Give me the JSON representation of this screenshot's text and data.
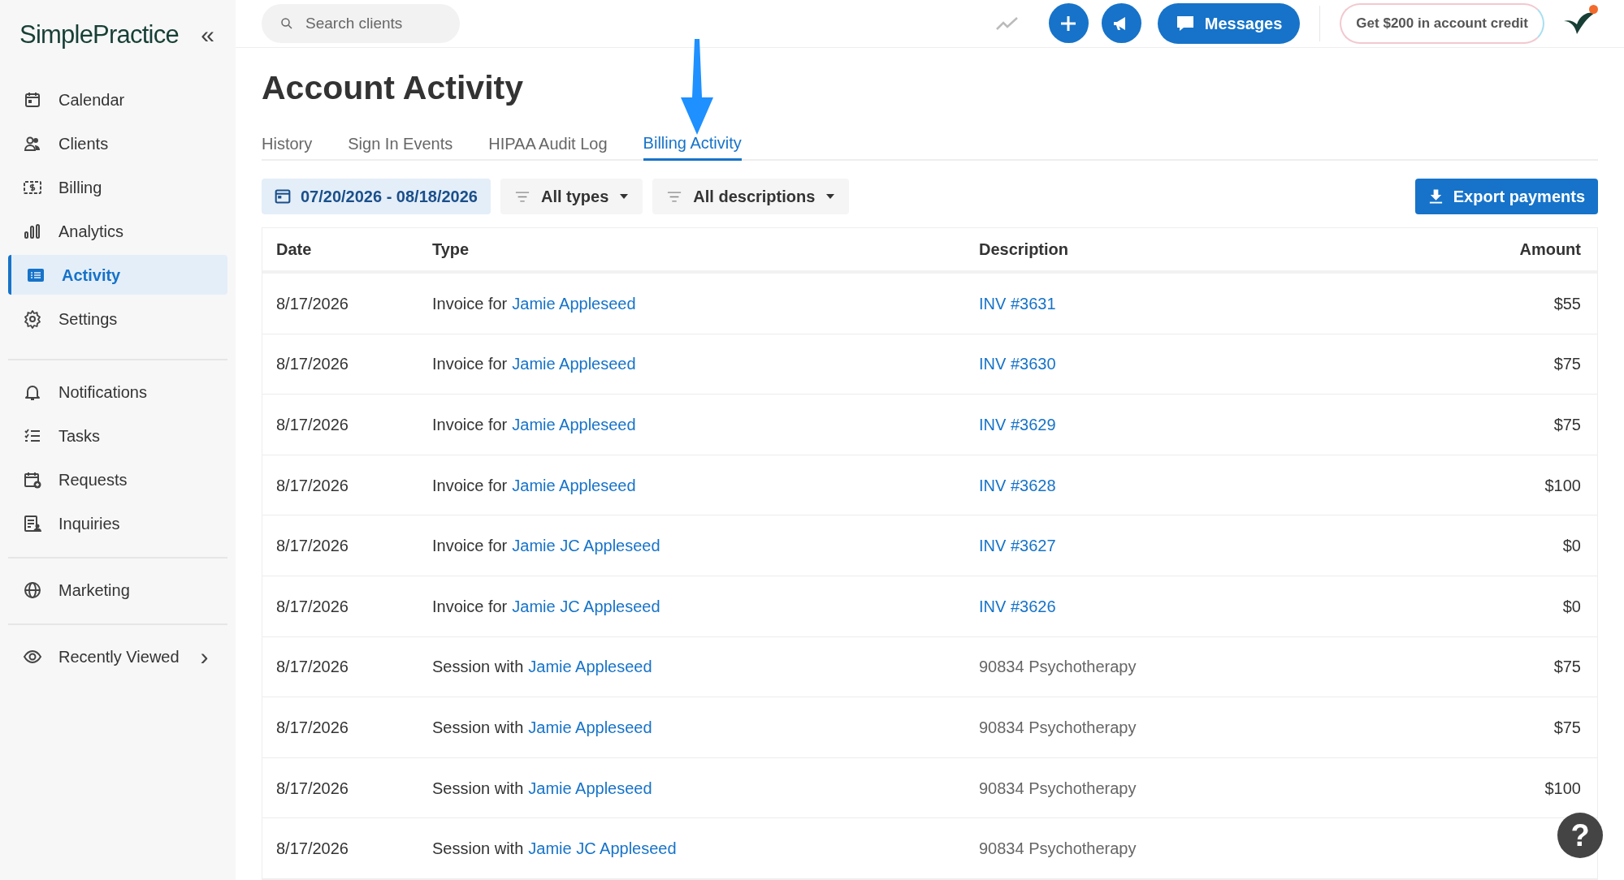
{
  "sidebar": {
    "logo": "SimplePractice",
    "collapse": "«",
    "groups": [
      [
        {
          "label": "Calendar",
          "selected": false
        },
        {
          "label": "Clients",
          "selected": false
        },
        {
          "label": "Billing",
          "selected": false
        },
        {
          "label": "Analytics",
          "selected": false
        },
        {
          "label": "Activity",
          "selected": true
        },
        {
          "label": "Settings",
          "selected": false
        }
      ],
      [
        {
          "label": "Notifications",
          "selected": false
        },
        {
          "label": "Tasks",
          "selected": false
        },
        {
          "label": "Requests",
          "selected": false
        },
        {
          "label": "Inquiries",
          "selected": false
        }
      ],
      [
        {
          "label": "Marketing",
          "selected": false
        }
      ],
      [
        {
          "label": "Recently Viewed",
          "selected": false,
          "chevron": "›"
        }
      ]
    ]
  },
  "topbar": {
    "search": {
      "placeholder": "Search clients"
    },
    "messages": "Messages",
    "promo": "Get $200 in account credit",
    "avatar_badge": true
  },
  "page": {
    "title": "Account Activity",
    "tabs": [
      {
        "label": "History",
        "selected": false
      },
      {
        "label": "Sign In Events",
        "selected": false
      },
      {
        "label": "HIPAA Audit Log",
        "selected": false
      },
      {
        "label": "Billing Activity",
        "selected": true
      }
    ],
    "filters": {
      "date_range": "07/20/2026 - 08/18/2026",
      "types": "All types",
      "descriptions": "All descriptions"
    },
    "export": "Export payments"
  },
  "table": {
    "columns": [
      "Date",
      "Type",
      "Description",
      "Amount"
    ],
    "rows": [
      {
        "date": "8/17/2026",
        "kind": "invoice",
        "type_prefix": "Invoice for",
        "client": "Jamie Appleseed",
        "description": "INV #3631",
        "amount": "$55"
      },
      {
        "date": "8/17/2026",
        "kind": "invoice",
        "type_prefix": "Invoice for",
        "client": "Jamie Appleseed",
        "description": "INV #3630",
        "amount": "$75"
      },
      {
        "date": "8/17/2026",
        "kind": "invoice",
        "type_prefix": "Invoice for",
        "client": "Jamie Appleseed",
        "description": "INV #3629",
        "amount": "$75"
      },
      {
        "date": "8/17/2026",
        "kind": "invoice",
        "type_prefix": "Invoice for",
        "client": "Jamie Appleseed",
        "description": "INV #3628",
        "amount": "$100"
      },
      {
        "date": "8/17/2026",
        "kind": "invoice",
        "type_prefix": "Invoice for",
        "client": "Jamie JC Appleseed",
        "description": "INV #3627",
        "amount": "$0"
      },
      {
        "date": "8/17/2026",
        "kind": "invoice",
        "type_prefix": "Invoice for",
        "client": "Jamie JC Appleseed",
        "description": "INV #3626",
        "amount": "$0"
      },
      {
        "date": "8/17/2026",
        "kind": "session",
        "type_prefix": "Session with",
        "client": "Jamie Appleseed",
        "description": "90834 Psychotherapy",
        "amount": "$75"
      },
      {
        "date": "8/17/2026",
        "kind": "session",
        "type_prefix": "Session with",
        "client": "Jamie Appleseed",
        "description": "90834 Psychotherapy",
        "amount": "$75"
      },
      {
        "date": "8/17/2026",
        "kind": "session",
        "type_prefix": "Session with",
        "client": "Jamie Appleseed",
        "description": "90834 Psychotherapy",
        "amount": "$100"
      },
      {
        "date": "8/17/2026",
        "kind": "session",
        "type_prefix": "Session with",
        "client": "Jamie JC Appleseed",
        "description": "90834 Psychotherapy"
      }
    ]
  },
  "help": "?"
}
